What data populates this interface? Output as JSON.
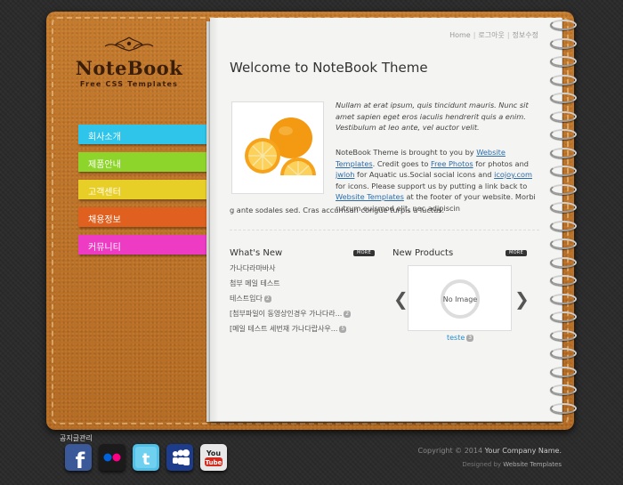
{
  "logo": {
    "title": "NoteBook",
    "subtitle": "Free CSS Templates"
  },
  "nav": [
    {
      "label": "회사소개",
      "color": "#2fc4ea"
    },
    {
      "label": "제품안내",
      "color": "#8ed52b"
    },
    {
      "label": "고객센터",
      "color": "#e8cf28"
    },
    {
      "label": "채용정보",
      "color": "#e0611f"
    },
    {
      "label": "커뮤니티",
      "color": "#ee3bc4"
    }
  ],
  "util_links": {
    "home": "Home",
    "logout": "로그아웃",
    "profile": "정보수정"
  },
  "welcome_title": "Welcome to NoteBook Theme",
  "intro_italic": "Nullam at erat ipsum, quis tincidunt mauris. Nunc sit amet sapien eget eros iaculis hendrerit quis a enim. Vestibulum at leo ante, vel auctor velit.",
  "intro": {
    "p1": "NoteBook Theme is brought to you by ",
    "link1": "Website Templates",
    "p2": ". Credit goes to ",
    "link2": "Free Photos",
    "p3": " for photos and ",
    "link3": "jwloh",
    "p4": " for Aquatic us.Social social icons and ",
    "link4": "icojoy.com",
    "p5": " for icons. Please support us by putting a link back to ",
    "link5": "Website Templates",
    "p6": " at the footer of your website. Morbi rutrum euismod elit, nec adipiscin",
    "p7": "g ante sodales sed. Cras accumsan congue turpis a luctus."
  },
  "whats_new": {
    "title": "What's New",
    "more": "MORE",
    "items": [
      {
        "text": "가나다라마바사",
        "badge": ""
      },
      {
        "text": "첨부 메일 테스트",
        "badge": ""
      },
      {
        "text": "테스트입다",
        "badge": "2"
      },
      {
        "text": "[첨부파일이 동영상인경우 가나다라...",
        "badge": "2"
      },
      {
        "text": "[메일 테스트 세번재 가나다랍사우...",
        "badge": "5"
      }
    ]
  },
  "new_products": {
    "title": "New Products",
    "more": "MORE",
    "placeholder": "No Image",
    "caption": "teste",
    "badge": "3"
  },
  "footer": {
    "label": "공지글관리",
    "copyright_prefix": "Copyright © 2014",
    "company": "Your Company Name.",
    "designed_prefix": "Designed by",
    "designed_link": "Website Templates"
  },
  "social": [
    {
      "name": "facebook",
      "glyph": "f",
      "color": "#3b5998"
    },
    {
      "name": "flickr",
      "glyph": "••",
      "color": "#1b1b1b"
    },
    {
      "name": "twitter",
      "glyph": "t",
      "color": "#4fc1e9"
    },
    {
      "name": "myspace",
      "glyph": "✦",
      "color": "#1e3c8c"
    },
    {
      "name": "youtube",
      "glyph": "You Tube",
      "color": "#e8e8e8"
    }
  ]
}
